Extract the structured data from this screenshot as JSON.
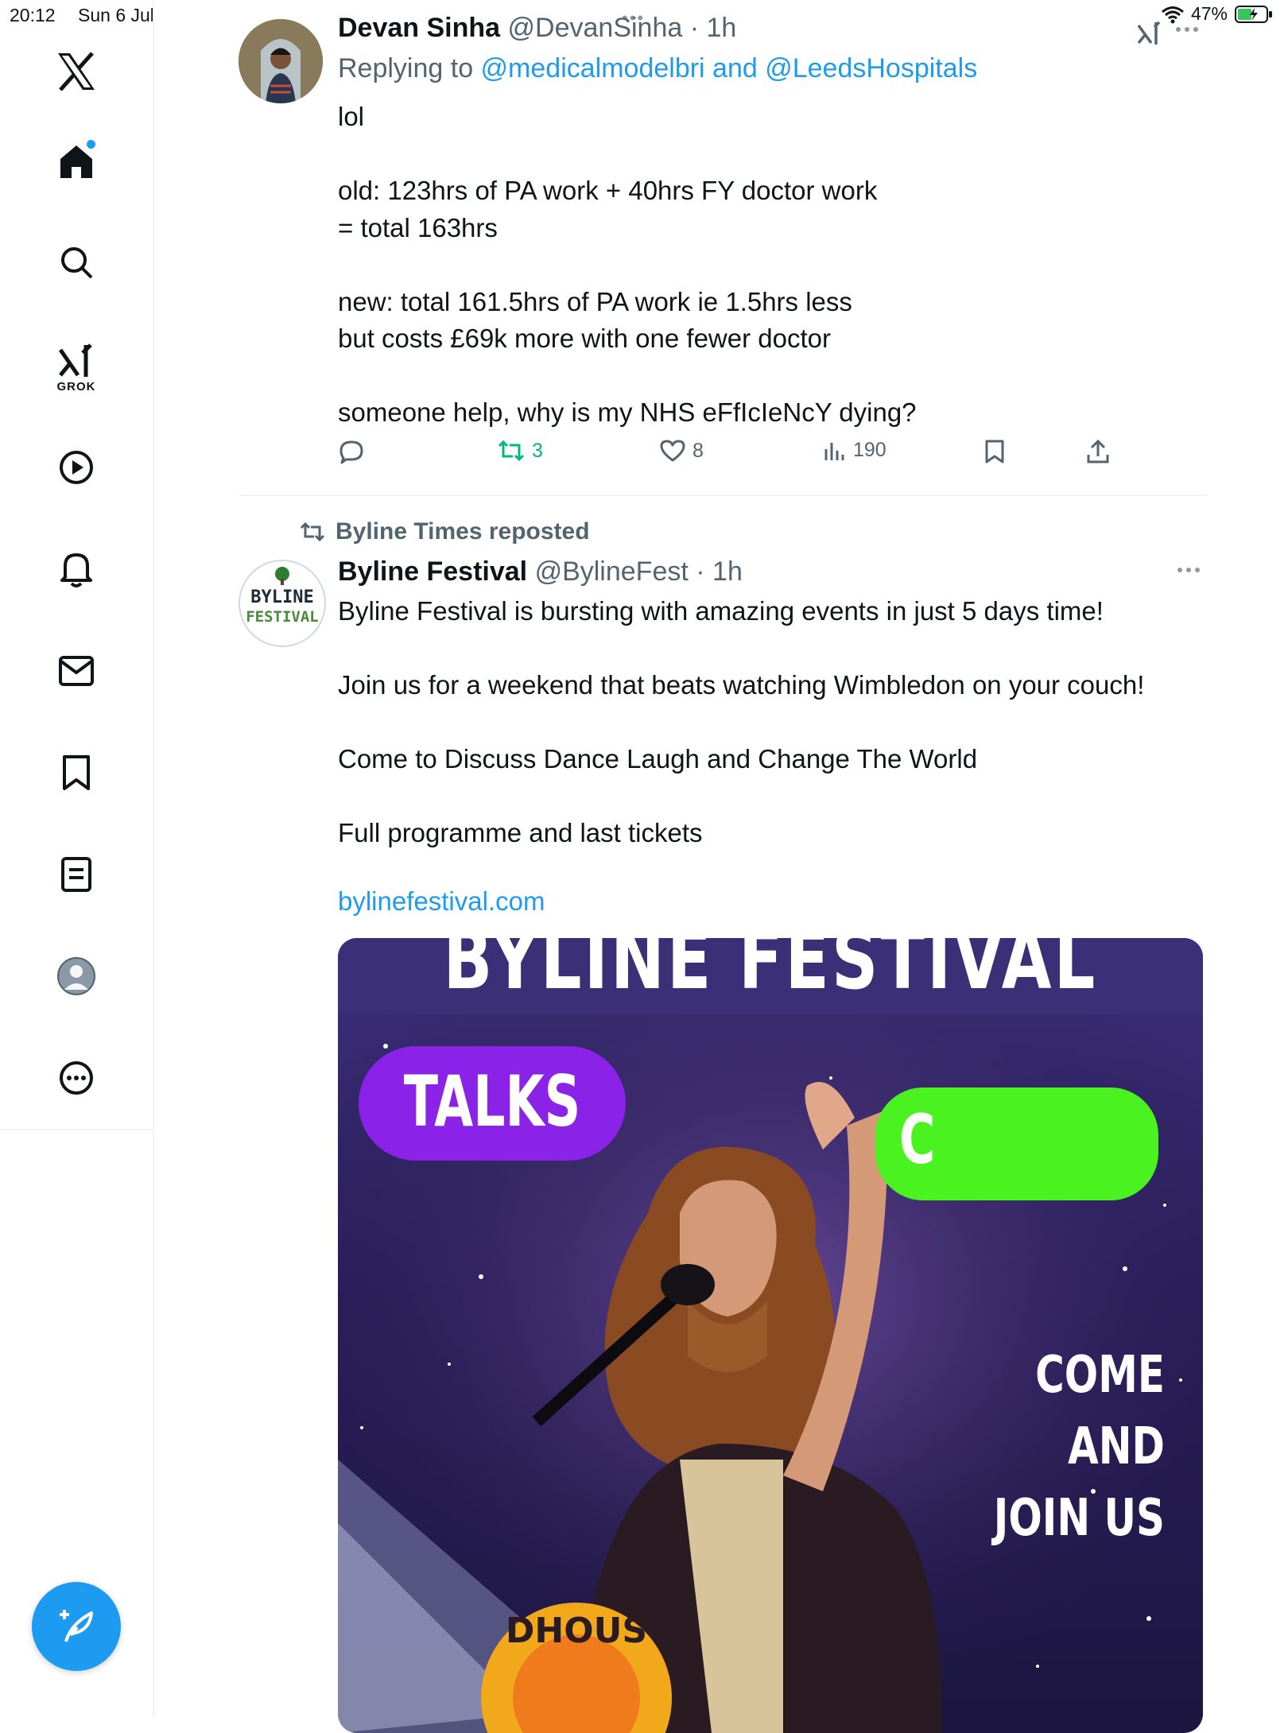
{
  "status_bar": {
    "time": "20:12",
    "date": "Sun 6 Jul",
    "battery": "47%"
  },
  "sidebar": {
    "grok_label": "GROK"
  },
  "tweet1": {
    "name": "Devan Sinha",
    "handle": "@DevanSinha",
    "time": "· 1h",
    "replying_prefix": "Replying to ",
    "replying_users": "@medicalmodelbri and @LeedsHospitals",
    "text": "lol\n\nold: 123hrs of PA work + 40hrs FY doctor work\n= total 163hrs\n\nnew: total 161.5hrs of PA work ie 1.5hrs less\nbut costs £69k more with one fewer doctor\n\nsomeone help, why is my NHS eFfIcIeNcY dying?",
    "retweets": "3",
    "likes": "8",
    "views": "190"
  },
  "tweet2": {
    "reposted_by": "Byline Times reposted",
    "name": "Byline Festival",
    "handle": "@BylineFest",
    "time": "· 1h",
    "avatar_line1": "BYLINE",
    "avatar_line2": "FESTIVAL",
    "text": "Byline Festival is bursting with amazing events in just 5 days time!\n\nJoin us for a weekend that beats watching Wimbledon on your couch!\n\nCome to Discuss Dance Laugh and Change The World\n\nFull programme and last tickets",
    "link": "bylinefestival.com",
    "media": {
      "banner": "BYLINE FESTIVAL",
      "pill_talks": "TALKS",
      "pill_green": "C",
      "caption": "COME AND\nJOIN US",
      "badge": "DHOUS"
    }
  },
  "colors": {
    "accent": "#1d9bf0",
    "retweet_green": "#00ba7c",
    "secondary_text": "#536471",
    "talks_purple": "#8a22e8",
    "pill_green": "#4af31f"
  }
}
